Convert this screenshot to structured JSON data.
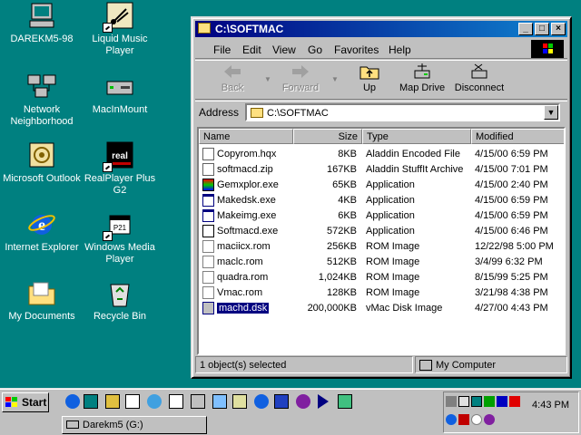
{
  "desktop": {
    "icons": [
      {
        "label": "DAREKM5-98"
      },
      {
        "label": "Liquid Music Player"
      },
      {
        "label": "Network Neighborhood"
      },
      {
        "label": "MacInMount"
      },
      {
        "label": "Microsoft Outlook"
      },
      {
        "label": "RealPlayer Plus G2"
      },
      {
        "label": "Internet Explorer"
      },
      {
        "label": "Windows Media Player"
      },
      {
        "label": "My Documents"
      },
      {
        "label": "Recycle Bin"
      }
    ]
  },
  "window": {
    "title": "C:\\SOFTMAC",
    "menu": [
      "File",
      "Edit",
      "View",
      "Go",
      "Favorites",
      "Help"
    ],
    "toolbar": {
      "back": "Back",
      "forward": "Forward",
      "up": "Up",
      "map_drive": "Map Drive",
      "disconnect": "Disconnect"
    },
    "address": {
      "label": "Address",
      "value": "C:\\SOFTMAC"
    },
    "columns": {
      "name": "Name",
      "size": "Size",
      "type": "Type",
      "modified": "Modified"
    },
    "files": [
      {
        "name": "Copyrom.hqx",
        "size": "8KB",
        "type": "Aladdin Encoded File",
        "modified": "4/15/00 6:59 PM",
        "icon": "encoded"
      },
      {
        "name": "softmacd.zip",
        "size": "167KB",
        "type": "Aladdin StuffIt Archive",
        "modified": "4/15/00 7:01 PM",
        "icon": "archive"
      },
      {
        "name": "Gemxplor.exe",
        "size": "65KB",
        "type": "Application",
        "modified": "4/15/00 2:40 PM",
        "icon": "app-color"
      },
      {
        "name": "Makedsk.exe",
        "size": "4KB",
        "type": "Application",
        "modified": "4/15/00 6:59 PM",
        "icon": "app"
      },
      {
        "name": "Makeimg.exe",
        "size": "6KB",
        "type": "Application",
        "modified": "4/15/00 6:59 PM",
        "icon": "app"
      },
      {
        "name": "Softmacd.exe",
        "size": "572KB",
        "type": "Application",
        "modified": "4/15/00 6:46 PM",
        "icon": "app-mac"
      },
      {
        "name": "maciicx.rom",
        "size": "256KB",
        "type": "ROM Image",
        "modified": "12/22/98 5:00 PM",
        "icon": "rom"
      },
      {
        "name": "maclc.rom",
        "size": "512KB",
        "type": "ROM Image",
        "modified": "3/4/99 6:32 PM",
        "icon": "rom"
      },
      {
        "name": "quadra.rom",
        "size": "1,024KB",
        "type": "ROM Image",
        "modified": "8/15/99 5:25 PM",
        "icon": "rom"
      },
      {
        "name": "Vmac.rom",
        "size": "128KB",
        "type": "ROM Image",
        "modified": "3/21/98 4:38 PM",
        "icon": "rom"
      },
      {
        "name": "machd.dsk",
        "size": "200,000KB",
        "type": "vMac Disk Image",
        "modified": "4/27/00 4:43 PM",
        "icon": "disk",
        "selected": true
      }
    ],
    "status": {
      "selection": "1 object(s) selected",
      "location": "My Computer"
    }
  },
  "taskbar": {
    "start": "Start",
    "task": "Darekm5 (G:)",
    "clock": "4:43 PM"
  },
  "colors": {
    "desktop": "#008080",
    "title_active": "#000080",
    "selection": "#000080"
  }
}
